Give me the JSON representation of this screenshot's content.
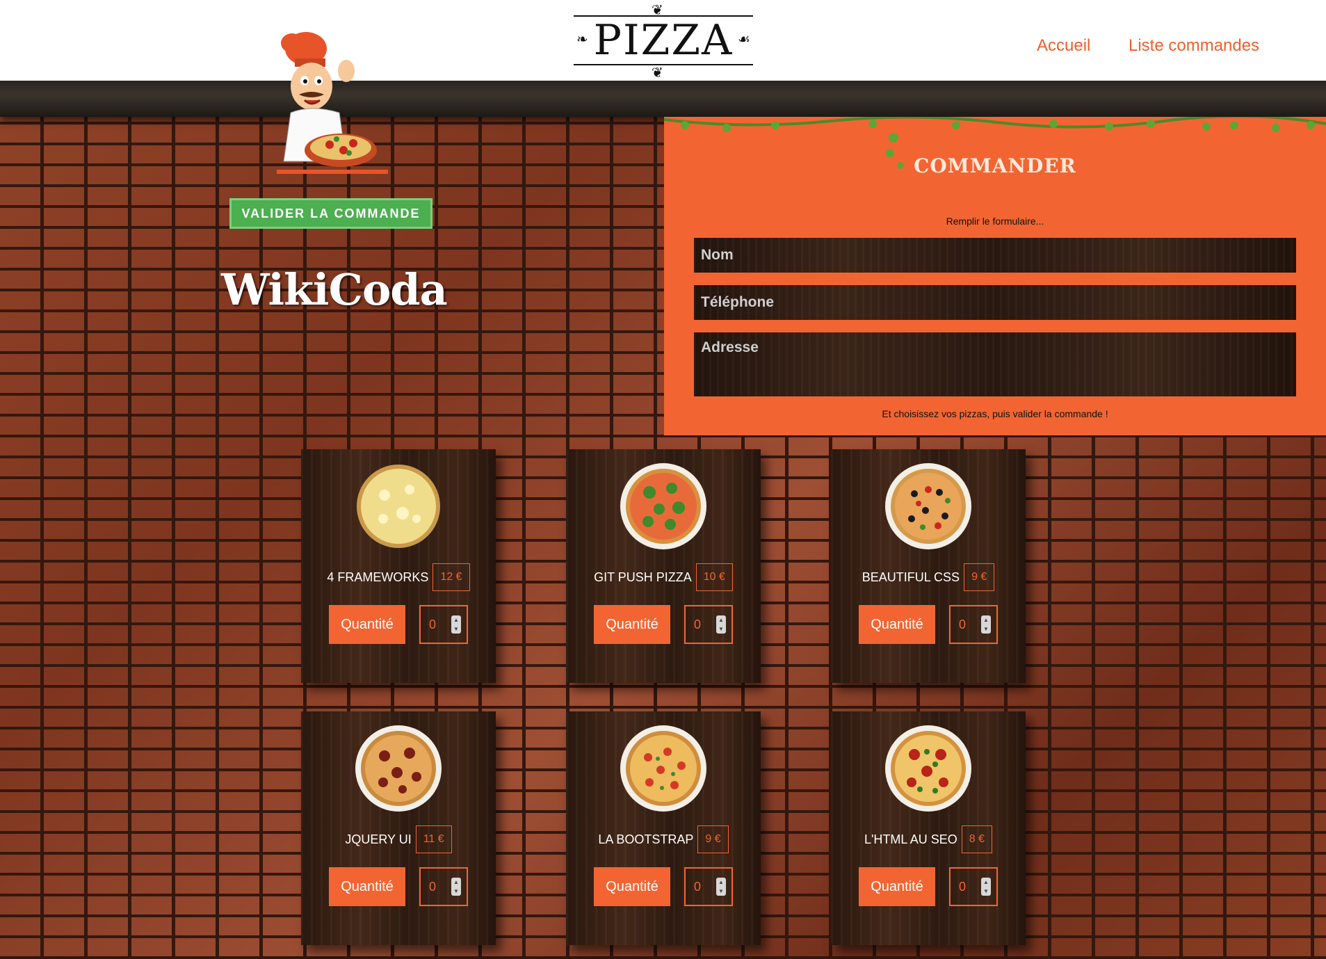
{
  "header": {
    "logo_text": "PIZZA",
    "nav": [
      {
        "label": "Accueil"
      },
      {
        "label": "Liste commandes"
      }
    ]
  },
  "sidebar": {
    "validate_button": "VALIDER LA COMMANDE",
    "brand": "WikiCoda"
  },
  "order_form": {
    "title": "COMMANDER",
    "subtitle": "Remplir le formulaire...",
    "fields": {
      "name_placeholder": "Nom",
      "phone_placeholder": "Téléphone",
      "address_placeholder": "Adresse"
    },
    "note": "Et choisissez vos pizzas, puis valider la commande !"
  },
  "pizzas": [
    {
      "name": "4 FRAMEWORKS",
      "price": "12 €",
      "qty_label": "Quantité",
      "qty": "0",
      "topping": "cheese"
    },
    {
      "name": "GIT PUSH PIZZA",
      "price": "10 €",
      "qty_label": "Quantité",
      "qty": "0",
      "topping": "broccoli"
    },
    {
      "name": "BEAUTIFUL CSS",
      "price": "9 €",
      "qty_label": "Quantité",
      "qty": "0",
      "topping": "olive"
    },
    {
      "name": "JQUERY UI",
      "price": "11 €",
      "qty_label": "Quantité",
      "qty": "0",
      "topping": "pepperoni"
    },
    {
      "name": "LA BOOTSTRAP",
      "price": "9 €",
      "qty_label": "Quantité",
      "qty": "0",
      "topping": "tomato"
    },
    {
      "name": "L'HTML AU SEO",
      "price": "8 €",
      "qty_label": "Quantité",
      "qty": "0",
      "topping": "salami"
    }
  ],
  "colors": {
    "accent": "#f26532",
    "validate_green": "#4caf50",
    "nav_orange": "#ef5f2c"
  }
}
